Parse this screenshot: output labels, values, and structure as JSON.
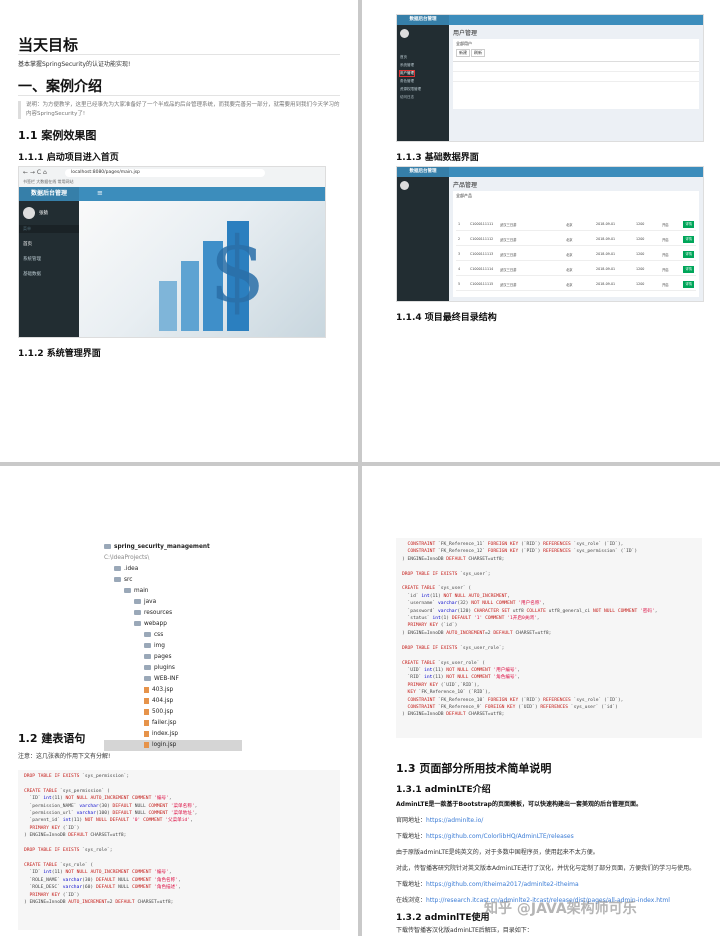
{
  "p1": {
    "title": "当天目标",
    "goal": "基本掌握SpringSecurity的认证功能实现!",
    "sec1": "一、案例介绍",
    "quote": "说明：为方便教学，这里已经事先为大家准备好了一个半成品的后台管理系统，而我要完善另一部分，就需要用到我们今天学习的内容SpringSecurity了!",
    "sec11": "1.1 案例效果图",
    "sec111": "1.1.1 启动项目进入首页",
    "url": "localhost:8080/pages/main.jsp",
    "bookmarks": "书签栏  大数据在线  常用网站",
    "logo": "数据后台管理",
    "user": "张猿",
    "menu_label": "菜单",
    "menu": [
      "首页",
      "系统管理",
      "基础数据"
    ],
    "sec112": "1.1.2 系统管理界面"
  },
  "p2": {
    "logo": "数据后台管理",
    "page1_title": "用户管理",
    "page1_sub": "全部用户",
    "sec113": "1.1.3 基础数据界面",
    "page2_title": "产品管理",
    "page2_sub": "全部产品",
    "sec114": "1.1.4 项目最终目录结构",
    "nav": [
      "首页",
      "系统管理",
      "用户管理",
      "角色管理",
      "资源权限管理",
      "访问日志"
    ],
    "product_rows": [
      {
        "id": "1",
        "num": "C1000111111",
        "name": "武汉三日游",
        "city": "北京",
        "time": "2018-09-01",
        "price": "1200",
        "status": "开启"
      },
      {
        "id": "2",
        "num": "C1000111112",
        "name": "武汉三日游",
        "city": "北京",
        "time": "2018-09-01",
        "price": "1200",
        "status": "开启"
      },
      {
        "id": "3",
        "num": "C1000111113",
        "name": "武汉三日游",
        "city": "北京",
        "time": "2018-09-01",
        "price": "1200",
        "status": "开启"
      },
      {
        "id": "4",
        "num": "C1000111114",
        "name": "武汉三日游",
        "city": "北京",
        "time": "2018-09-01",
        "price": "1200",
        "status": "开启"
      },
      {
        "id": "5",
        "num": "C1000111115",
        "name": "武汉三日游",
        "city": "北京",
        "time": "2018-09-01",
        "price": "1200",
        "status": "开启"
      }
    ]
  },
  "p3": {
    "project": "spring_security_management",
    "project_path": "C:\\IdeaProjects\\",
    "tree": [
      {
        "label": ".idea",
        "indent": 1,
        "type": "folder"
      },
      {
        "label": "src",
        "indent": 1,
        "type": "folder"
      },
      {
        "label": "main",
        "indent": 2,
        "type": "folder"
      },
      {
        "label": "java",
        "indent": 3,
        "type": "folder"
      },
      {
        "label": "resources",
        "indent": 3,
        "type": "folder"
      },
      {
        "label": "webapp",
        "indent": 3,
        "type": "folder"
      },
      {
        "label": "css",
        "indent": 4,
        "type": "folder"
      },
      {
        "label": "img",
        "indent": 4,
        "type": "folder"
      },
      {
        "label": "pages",
        "indent": 4,
        "type": "folder"
      },
      {
        "label": "plugins",
        "indent": 4,
        "type": "folder"
      },
      {
        "label": "WEB-INF",
        "indent": 4,
        "type": "folder"
      },
      {
        "label": "403.jsp",
        "indent": 4,
        "type": "jsp"
      },
      {
        "label": "404.jsp",
        "indent": 4,
        "type": "jsp"
      },
      {
        "label": "500.jsp",
        "indent": 4,
        "type": "jsp"
      },
      {
        "label": "failer.jsp",
        "indent": 4,
        "type": "jsp"
      },
      {
        "label": "index.jsp",
        "indent": 4,
        "type": "jsp"
      },
      {
        "label": "login.jsp",
        "indent": 4,
        "type": "jsp"
      }
    ],
    "sec12": "1.2 建表语句",
    "note": "注意：这几张表的作用下文有分解!",
    "code": [
      "DROP TABLE IF EXISTS `sys_permission`;",
      "",
      "CREATE TABLE `sys_permission` (",
      "  `ID` int(11) NOT NULL AUTO_INCREMENT COMMENT '编号',",
      "  `permission_NAME` varchar(30) DEFAULT NULL COMMENT '菜单名称',",
      "  `permission_url` varchar(100) DEFAULT NULL COMMENT '菜单地址',",
      "  `parent_id` int(11) NOT NULL DEFAULT '0' COMMENT '父菜单id',",
      "  PRIMARY KEY (`ID`)",
      ") ENGINE=InnoDB DEFAULT CHARSET=utf8;",
      "",
      "DROP TABLE IF EXISTS `sys_role`;",
      "",
      "CREATE TABLE `sys_role` (",
      "  `ID` int(11) NOT NULL AUTO_INCREMENT COMMENT '编号',",
      "  `ROLE_NAME` varchar(30) DEFAULT NULL COMMENT '角色名称',",
      "  `ROLE_DESC` varchar(60) DEFAULT NULL COMMENT '角色描述',",
      "  PRIMARY KEY (`ID`)",
      ") ENGINE=InnoDB AUTO_INCREMENT=2 DEFAULT CHARSET=utf8;"
    ]
  },
  "p4": {
    "code": [
      "  CONSTRAINT `FK_Reference_11` FOREIGN KEY (`RID`) REFERENCES `sys_role` (`ID`),",
      "  CONSTRAINT `FK_Reference_12` FOREIGN KEY (`PID`) REFERENCES `sys_permission` (`ID`)",
      ") ENGINE=InnoDB DEFAULT CHARSET=utf8;",
      "",
      "DROP TABLE IF EXISTS `sys_user`;",
      "",
      "CREATE TABLE `sys_user` (",
      "  `id` int(11) NOT NULL AUTO_INCREMENT,",
      "  `username` varchar(32) NOT NULL COMMENT '用户名称',",
      "  `password` varchar(120) CHARACTER SET utf8 COLLATE utf8_general_ci NOT NULL COMMENT '密码',",
      "  `status` int(1) DEFAULT '1' COMMENT '1开启0关闭',",
      "  PRIMARY KEY (`id`)",
      ") ENGINE=InnoDB AUTO_INCREMENT=2 DEFAULT CHARSET=utf8;",
      "",
      "DROP TABLE IF EXISTS `sys_user_role`;",
      "",
      "CREATE TABLE `sys_user_role` (",
      "  `UID` int(11) NOT NULL COMMENT '用户编号',",
      "  `RID` int(11) NOT NULL COMMENT '角色编号',",
      "  PRIMARY KEY (`UID`,`RID`),",
      "  KEY `FK_Reference_10` (`RID`),",
      "  CONSTRAINT `FK_Reference_10` FOREIGN KEY (`RID`) REFERENCES `sys_role` (`ID`),",
      "  CONSTRAINT `FK_Reference_9` FOREIGN KEY (`UID`) REFERENCES `sys_user` (`id`)",
      ") ENGINE=InnoDB DEFAULT CHARSET=utf8;"
    ],
    "sec13": "1.3 页面部分所用技术简单说明",
    "sec131": "1.3.1 adminLTE介绍",
    "intro_bold": "AdminLTE是一款基于Bootstrap的页面模板，可以快速构建出一套美观的后台管理页面。",
    "official_label": "官网地址：",
    "official_url": "https://adminlte.io/",
    "download_label": "下载地址：",
    "download_url": "https://github.com/ColorlibHQ/AdminLTE/releases",
    "para1": "由于原版adminLTE是纯英文的，对于多数中国程序员，使用起来不太方便。",
    "para2": "对此，传智播客研究院针对英文版本AdminLTE进行了汉化，并优化与定制了部分页面，方便我们的学习与使用。",
    "dl2_label": "下载地址：",
    "dl2_url": "https://github.com/itheima2017/adminlte2-itheima",
    "preview_label": "在线浏览：",
    "preview_url": "http://research.itcast.cn/adminlte2-itcast/release/dist/pages/all-admin-index.html",
    "sec132": "1.3.2 adminlTE使用",
    "para3": "下载传智播客汉化版adminLTE后解压，目录如下：",
    "watermark": "知乎 @JAVA架构师可乐"
  }
}
